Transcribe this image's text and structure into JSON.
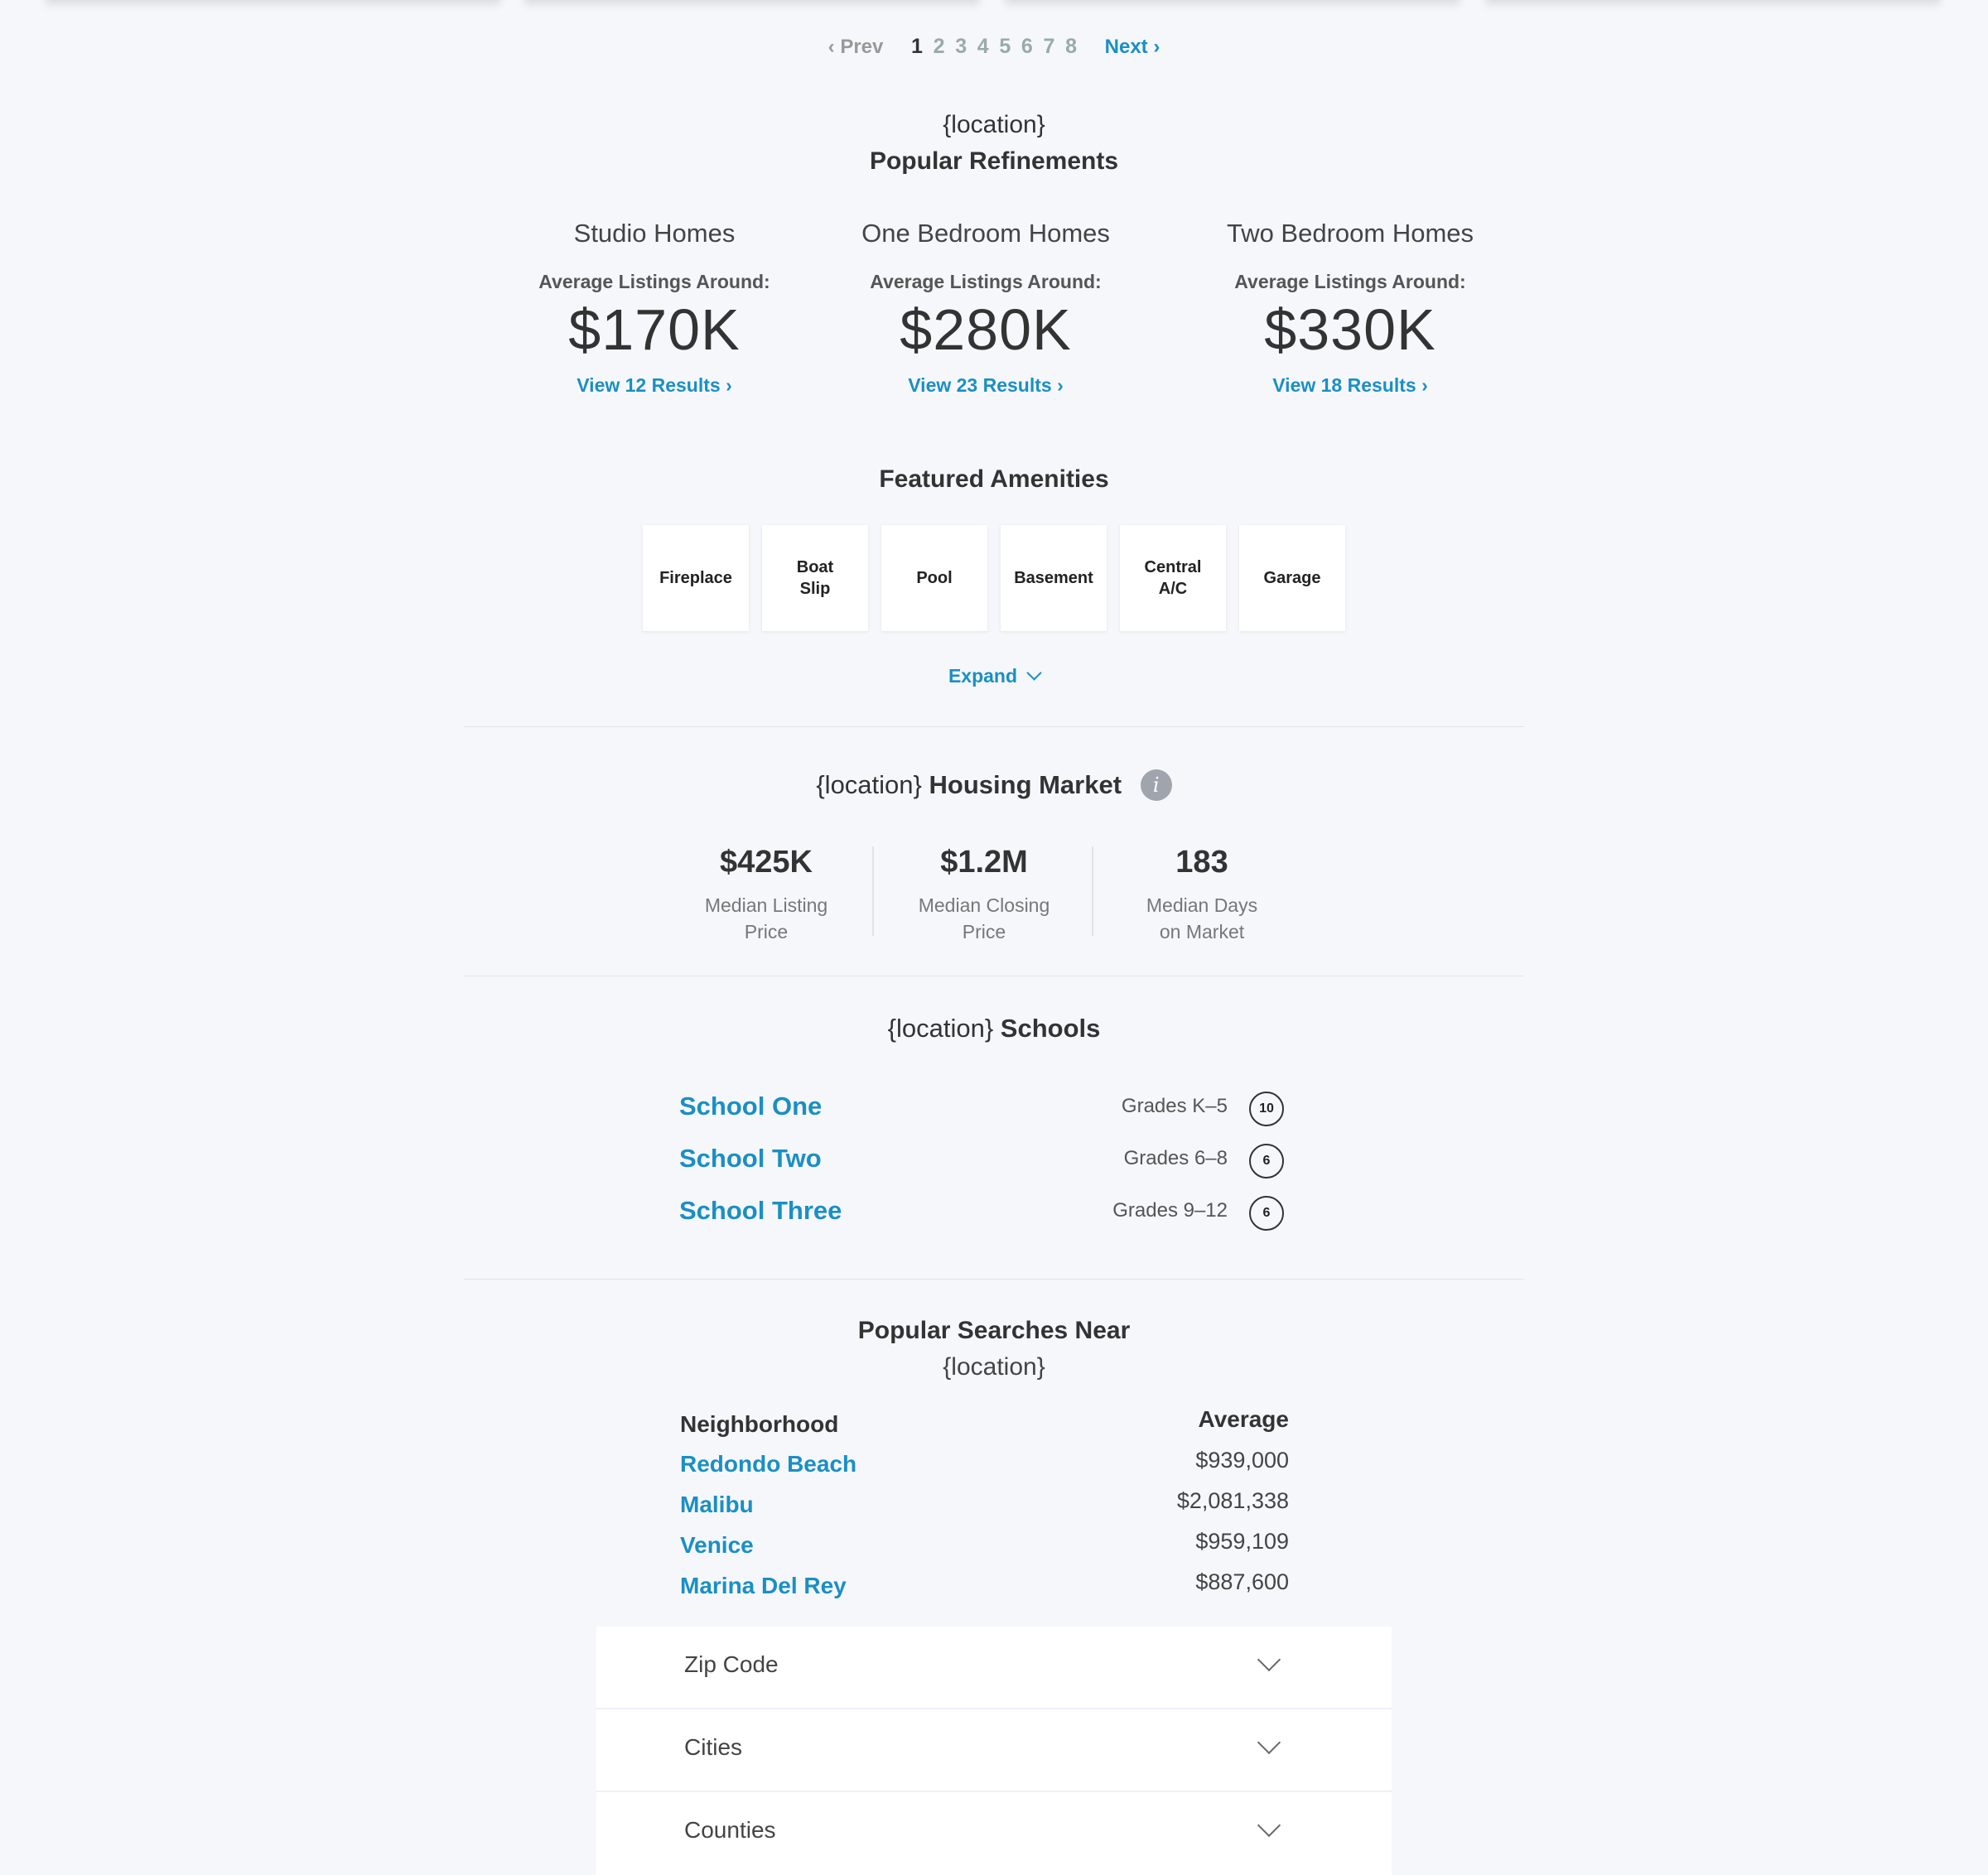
{
  "pagination": {
    "prev_label": "‹ Prev",
    "pages": [
      "1",
      "2",
      "3",
      "4",
      "5",
      "6",
      "7",
      "8"
    ],
    "current_page": "1",
    "next_label": "Next ›"
  },
  "refinements": {
    "location": "{location}",
    "title": "Popular Refinements",
    "items": [
      {
        "name": "Studio Homes",
        "avg_label": "Average Listings Around:",
        "price": "$170K",
        "link": "View 12 Results ›"
      },
      {
        "name": "One Bedroom Homes",
        "avg_label": "Average Listings Around:",
        "price": "$280K",
        "link": "View 23 Results ›"
      },
      {
        "name": "Two Bedroom Homes",
        "avg_label": "Average Listings Around:",
        "price": "$330K",
        "link": "View 18 Results ›"
      }
    ]
  },
  "amenities": {
    "title": "Featured Amenities",
    "items": [
      "Fireplace",
      "Boat Slip",
      "Pool",
      "Basement",
      "Central A/C",
      "Garage"
    ],
    "expand_label": "Expand"
  },
  "market": {
    "location": "{location}",
    "title": "Housing Market",
    "info_icon": "info-icon",
    "stats": [
      {
        "value": "$425K",
        "label": "Median Listing Price"
      },
      {
        "value": "$1.2M",
        "label": "Median Closing Price"
      },
      {
        "value": "183",
        "label": "Median Days on Market"
      }
    ]
  },
  "schools": {
    "location": "{location}",
    "title": "Schools",
    "items": [
      {
        "name": "School One",
        "grades": "Grades K–5",
        "rating": "10"
      },
      {
        "name": "School Two",
        "grades": "Grades 6–8",
        "rating": "6"
      },
      {
        "name": "School Three",
        "grades": "Grades 9–12",
        "rating": "6"
      }
    ]
  },
  "popular_searches": {
    "title": "Popular Searches Near",
    "location": "{location}",
    "col_neighborhood": "Neighborhood",
    "col_average": "Average",
    "rows": [
      {
        "name": "Redondo Beach",
        "average": "$939,000"
      },
      {
        "name": "Malibu",
        "average": "$2,081,338"
      },
      {
        "name": "Venice",
        "average": "$959,109"
      },
      {
        "name": "Marina Del Rey",
        "average": "$887,600"
      }
    ]
  },
  "accordions": [
    "Zip Code",
    "Cities",
    "Counties"
  ],
  "colors": {
    "accent": "#1a8fc4",
    "background": "#f6f7fb",
    "text": "#333333"
  }
}
